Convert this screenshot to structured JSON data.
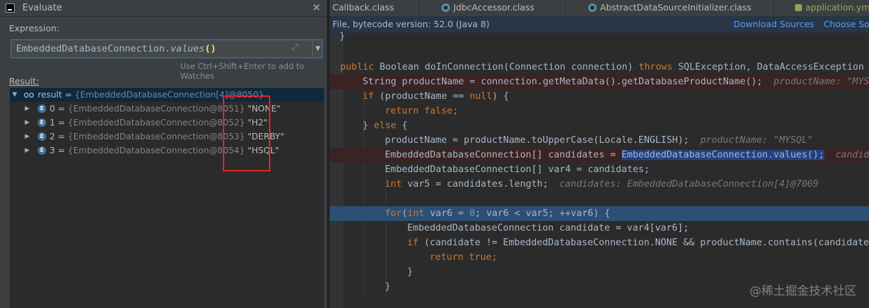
{
  "dialog": {
    "title": "Evaluate",
    "expression_label": "Expression:",
    "expression": {
      "receiver": "EmbeddedDatabaseConnection.",
      "method": "values",
      "parens": "()"
    },
    "hint": "Use Ctrl+Shift+Enter to add to Watches",
    "result_label": "Result:",
    "result": {
      "name": "result",
      "eq": " = ",
      "value": "{EmbeddedDatabaseConnection[4]@8050}"
    },
    "items": [
      {
        "index": "0",
        "eq": " = ",
        "type": "{EmbeddedDatabaseConnection@8051}",
        "value": " \"NONE\""
      },
      {
        "index": "1",
        "eq": " = ",
        "type": "{EmbeddedDatabaseConnection@8052}",
        "value": " \"H2\""
      },
      {
        "index": "2",
        "eq": " = ",
        "type": "{EmbeddedDatabaseConnection@8053}",
        "value": " \"DERBY\""
      },
      {
        "index": "3",
        "eq": " = ",
        "type": "{EmbeddedDatabaseConnection@8054}",
        "value": " \"HSQL\""
      }
    ],
    "badge_letter": "E",
    "close_glyph": "✕",
    "expand_glyph": "⤢",
    "history_glyph": "▼",
    "icons": {
      "app": "intellij-icon",
      "watch": "watch-glasses-icon",
      "enum": "enum-badge-icon"
    }
  },
  "editor": {
    "tabs": [
      {
        "label": "Callback.class",
        "icon": "class-file-icon"
      },
      {
        "label": "JdbcAccessor.class",
        "icon": "class-file-icon"
      },
      {
        "label": "AbstractDataSourceInitializer.class",
        "icon": "class-file-icon"
      },
      {
        "label": "application.ym",
        "icon": "yaml-file-icon"
      }
    ],
    "info_text": "File, bytecode version: 52.0 (Java 8)",
    "download_sources": "Download Sources",
    "choose_sources": "Choose Sou",
    "code": {
      "l0": "}",
      "l1_kw": "public",
      "l1_a": " Boolean doInConnection(Connection connection) ",
      "l1_kw2": "throws",
      "l1_b": " SQLException, DataAccessException {",
      "l2_a": "String productName = connection.getMetaData().getDatabaseProductName();",
      "l2_hint": "productName: \"MYSQ",
      "l3_kw": "if",
      "l3_a": " (productName == ",
      "l3_kw2": "null",
      "l3_b": ") {",
      "l4_kw": "return false",
      "l4_a": ";",
      "l5_a": "} ",
      "l5_kw": "else",
      "l5_b": " {",
      "l6_a": "productName = productName.toUpperCase(Locale.ENGLISH);",
      "l6_hint": "productName: \"MYSQL\"",
      "l7_a": "EmbeddedDatabaseConnection[] candidates = ",
      "l7_sel": "EmbeddedDatabaseConnection.values();",
      "l7_hint": "candida",
      "l8_a": "EmbeddedDatabaseConnection[] var4 = candidates;",
      "l9_kw": "int",
      "l9_a": " var5 = candidates.length;",
      "l9_hint": "candidates: EmbeddedDatabaseConnection[4]@7069",
      "l11_kw": "for",
      "l11_a": "(",
      "l11_kw2": "int",
      "l11_b": " var6 = ",
      "l11_n": "0",
      "l11_c": "; var6 < var5; ++var6) {",
      "l12_a": "EmbeddedDatabaseConnection candidate = var4[var6];",
      "l13_kw": "if",
      "l13_a": " (candidate != EmbeddedDatabaseConnection.NONE && productName.contains(candidate.",
      "l14_kw": "return true",
      "l14_a": ";",
      "l15_a": "}",
      "l16_a": "}"
    },
    "watermark": "@稀土掘金技术社区"
  },
  "colors": {
    "background": "#2b2b2b",
    "panel": "#3c3f41",
    "selection": "#0d293e",
    "keyword": "#cc7832",
    "link": "#589df6",
    "annotation_box": "#e8232a"
  }
}
